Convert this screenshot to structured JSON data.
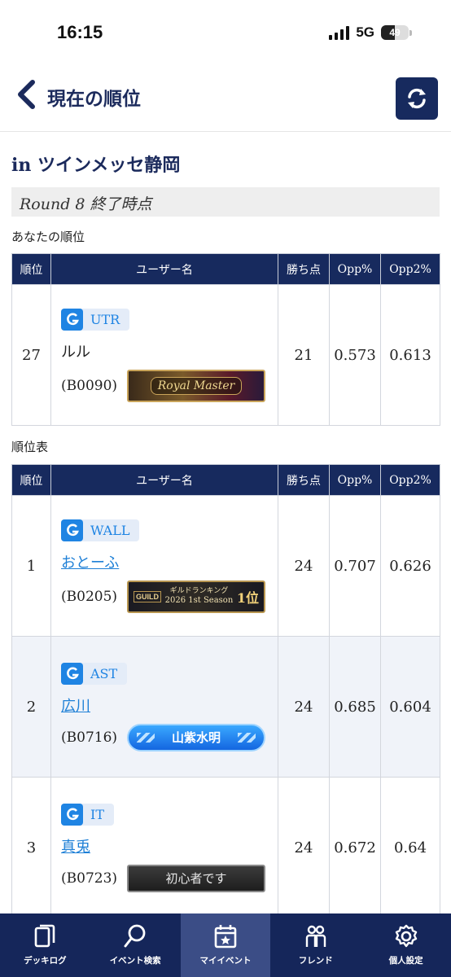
{
  "status": {
    "time": "16:15",
    "network": "5G",
    "battery": "49",
    "battery_level": 0.49
  },
  "header": {
    "title": "現在の順位"
  },
  "event": {
    "venue": "in ツインメッセ静岡",
    "round": "Round 8 終了時点"
  },
  "my_rank": {
    "label": "あなたの順位",
    "columns": [
      "順位",
      "ユーザー名",
      "勝ち点",
      "Opp%",
      "Opp2%"
    ],
    "row": {
      "rank": "27",
      "guild": "UTR",
      "name": "ルル",
      "user_id": "(B0090)",
      "title_badge": "Royal Master",
      "points": "21",
      "opp": "0.573",
      "opp2": "0.613"
    }
  },
  "standings": {
    "label": "順位表",
    "columns": [
      "順位",
      "ユーザー名",
      "勝ち点",
      "Opp%",
      "Opp2%"
    ],
    "rows": [
      {
        "rank": "1",
        "guild": "WALL",
        "name": "おとーふ",
        "user_id": "(B0205)",
        "title_badge": {
          "sub": "ギルドランキング",
          "season": "2026 1st Season",
          "place": "1位",
          "logo": "GUILD"
        },
        "points": "24",
        "opp": "0.707",
        "opp2": "0.626"
      },
      {
        "rank": "2",
        "guild": "AST",
        "name": "広川",
        "user_id": "(B0716)",
        "title_badge": "山紫水明",
        "points": "24",
        "opp": "0.685",
        "opp2": "0.604"
      },
      {
        "rank": "3",
        "guild": "IT",
        "name": "真兎",
        "user_id": "(B0723)",
        "title_badge": "初心者です",
        "points": "24",
        "opp": "0.672",
        "opp2": "0.64"
      }
    ]
  },
  "nav": [
    {
      "label": "デッキログ",
      "icon": "cards-icon"
    },
    {
      "label": "イベント検索",
      "icon": "search-icon"
    },
    {
      "label": "マイイベント",
      "icon": "calendar-star-icon",
      "active": true
    },
    {
      "label": "フレンド",
      "icon": "friends-icon"
    },
    {
      "label": "個人設定",
      "icon": "gear-icon"
    }
  ],
  "colors": {
    "navy": "#172a5e",
    "link": "#1d7fd6",
    "guild_blue": "#1f84e3",
    "nav_active": "#3b4d86"
  }
}
